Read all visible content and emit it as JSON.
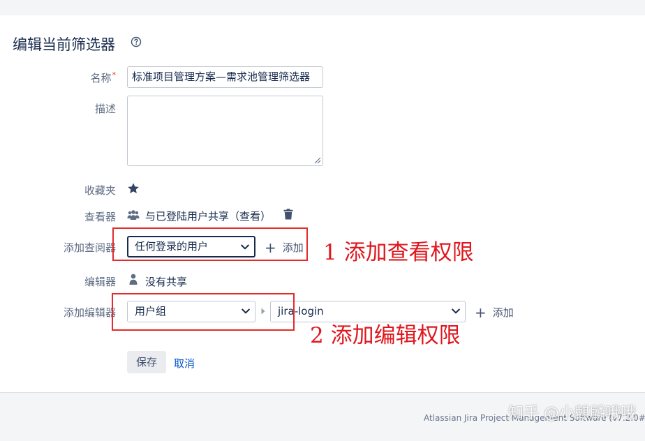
{
  "form": {
    "title": "编辑当前筛选器",
    "name_label": "名称",
    "required_mark": "*",
    "name_value": "标准项目管理方案—需求池管理筛选器",
    "description_label": "描述",
    "description_value": "",
    "favourite_label": "收藏夹",
    "viewers_label": "查看器",
    "viewers_value": "与已登陆用户共享（查看）",
    "add_viewer_label": "添加查阅器",
    "add_viewer_select": "任何登录的用户",
    "add_label": "添加",
    "editors_label": "编辑器",
    "editors_value": "没有共享",
    "add_editor_label": "添加编辑器",
    "add_editor_select": "用户组",
    "add_editor_group": "jira-login",
    "save_label": "保存",
    "cancel_label": "取消"
  },
  "annotations": {
    "step1": "1 添加查看权限",
    "step2": "2 添加编辑权限",
    "box_color": "#e32b2b"
  },
  "footer": {
    "text": "Atlassian Jira Project Management Software (v7.2.0#"
  },
  "watermark": {
    "text": "知乎 @小麒麟哦哦"
  },
  "icons": {
    "help": "question-circle-icon",
    "favourite": "star-icon",
    "viewers": "users-icon",
    "delete": "trash-icon",
    "editors": "person-icon",
    "dropdown": "chevron-down-icon",
    "add": "plus-icon"
  }
}
